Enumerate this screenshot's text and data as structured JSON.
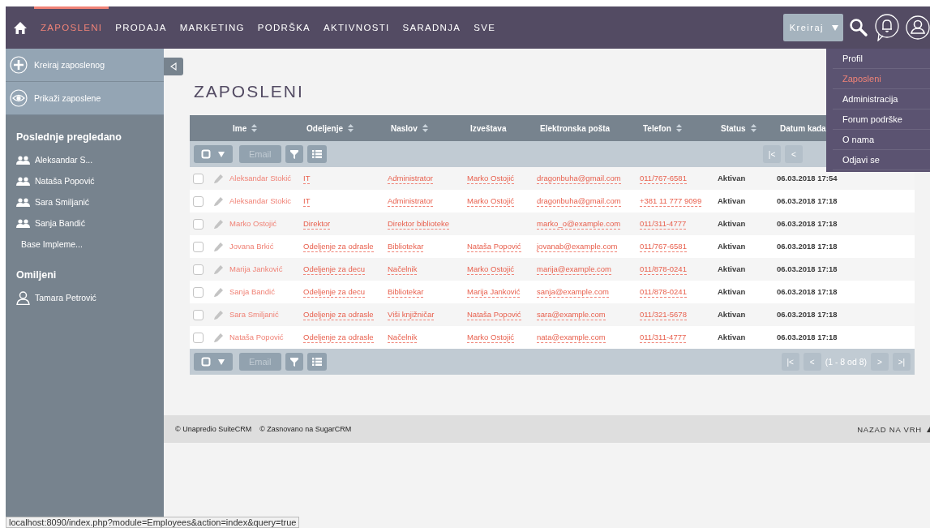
{
  "nav": {
    "tabs": [
      {
        "label": "ZAPOSLENI",
        "selected": true
      },
      {
        "label": "PRODAJA",
        "selected": false
      },
      {
        "label": "MARKETING",
        "selected": false
      },
      {
        "label": "PODRŠKA",
        "selected": false
      },
      {
        "label": "AKTIVNOSTI",
        "selected": false
      },
      {
        "label": "SARADNJA",
        "selected": false
      },
      {
        "label": "SVE",
        "selected": false
      }
    ],
    "create_button": "Kreiraj"
  },
  "user_menu": [
    {
      "label": "Profil",
      "selected": false
    },
    {
      "label": "Zaposleni",
      "selected": true
    },
    {
      "label": "Administracija",
      "selected": false
    },
    {
      "label": "Forum podrške",
      "selected": false
    },
    {
      "label": "O nama",
      "selected": false
    },
    {
      "label": "Odjavi se",
      "selected": false
    }
  ],
  "sidebar": {
    "actions": [
      {
        "label": "Kreiraj zaposlenog",
        "kind": "create"
      },
      {
        "label": "Prikaži zaposlene",
        "kind": "view"
      }
    ],
    "recent_title": "Poslednje pregledano",
    "recent": [
      {
        "label": "Aleksandar S...",
        "kind": "employee"
      },
      {
        "label": "Nataša Popović",
        "kind": "employee"
      },
      {
        "label": "Sara Smiljanić",
        "kind": "employee"
      },
      {
        "label": "Sanja Bandić",
        "kind": "employee"
      },
      {
        "label": "Base Impleme...",
        "kind": "plain"
      }
    ],
    "favorites_title": "Omiljeni",
    "favorites": [
      {
        "label": "Tamara Petrović"
      }
    ]
  },
  "page_title": "ZAPOSLENI",
  "table": {
    "columns": [
      {
        "label": "Ime",
        "sortable": true
      },
      {
        "label": "Odeljenje",
        "sortable": true
      },
      {
        "label": "Naslov",
        "sortable": true
      },
      {
        "label": "Izveštava",
        "sortable": false
      },
      {
        "label": "Elektronska pošta",
        "sortable": false
      },
      {
        "label": "Telefon",
        "sortable": true
      },
      {
        "label": "Status",
        "sortable": true
      },
      {
        "label": "Datum kada"
      }
    ],
    "top_toolbar": {
      "bulk_action": "Email",
      "pagination": [
        "|<",
        "<"
      ]
    },
    "bottom_toolbar": {
      "bulk_action": "Email",
      "pagination": {
        "first": "|<",
        "prev": "<",
        "range": "(1 - 8 od 8)",
        "next": ">",
        "last": ">|"
      }
    },
    "rows": [
      {
        "checked": false,
        "name": "Aleksandar Stokić",
        "department": "IT",
        "title": "Administrator",
        "reports_to": "Marko Ostojić",
        "email": "dragonbuha@gmail.com",
        "phone": "011/767-6581",
        "status": "Aktivan",
        "date": "06.03.2018 17:54"
      },
      {
        "checked": false,
        "name": "Aleksandar Stokic",
        "department": "IT",
        "title": "Administrator",
        "reports_to": "Marko Ostojić",
        "email": "dragonbuha@gmail.com",
        "phone": "+381 11 777 9099",
        "status": "Aktivan",
        "date": "06.03.2018 17:18"
      },
      {
        "checked": false,
        "name": "Marko Ostojić",
        "department": "Direktor",
        "title": "Direktor biblioteke",
        "reports_to": "",
        "email": "marko_o@example.com",
        "phone": "011/311-4777",
        "status": "Aktivan",
        "date": "06.03.2018 17:18"
      },
      {
        "checked": false,
        "name": "Jovana Brkić",
        "department": "Odeljenje za odrasle",
        "title": "Bibliotekar",
        "reports_to": "Nataša Popović",
        "email": "jovanab@example.com",
        "phone": "011/767-6581",
        "status": "Aktivan",
        "date": "06.03.2018 17:18"
      },
      {
        "checked": false,
        "name": "Marija Janković",
        "department": "Odeljenje za decu",
        "title": "Načelnik",
        "reports_to": "Marko Ostojić",
        "email": "marija@example.com",
        "phone": "011/878-0241",
        "status": "Aktivan",
        "date": "06.03.2018 17:18"
      },
      {
        "checked": false,
        "name": "Sanja Bandić",
        "department": "Odeljenje za decu",
        "title": "Bibliotekar",
        "reports_to": "Marija Janković",
        "email": "sanja@example.com",
        "phone": "011/878-0241",
        "status": "Aktivan",
        "date": "06.03.2018 17:18"
      },
      {
        "checked": false,
        "name": "Sara Smiljanić",
        "department": "Odeljenje za odrasle",
        "title": "Viši knjižničar",
        "reports_to": "Nataša Popović",
        "email": "sara@example.com",
        "phone": "011/321-5678",
        "status": "Aktivan",
        "date": "06.03.2018 17:18"
      },
      {
        "checked": false,
        "name": "Nataša Popović",
        "department": "Odeljenje za odrasle",
        "title": "Načelnik",
        "reports_to": "Marko Ostojić",
        "email": "nata@example.com",
        "phone": "011/311-4777",
        "status": "Aktivan",
        "date": "06.03.2018 17:18"
      }
    ]
  },
  "footer": {
    "links": [
      "© Unapredio SuiteCRM",
      "© Zasnovano na SugarCRM"
    ],
    "back_to_top": "NAZAD NA VRH"
  },
  "status_url": "localhost:8090/index.php?module=Employees&action=index&query=true"
}
